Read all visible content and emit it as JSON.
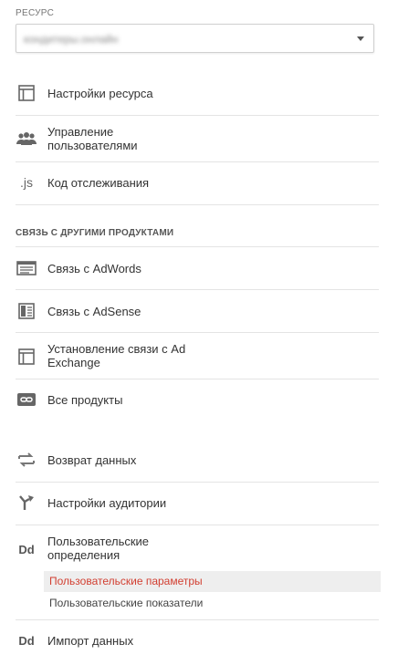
{
  "resource": {
    "section_label": "РЕСУРС",
    "selected_value": "кондитеры.онлайн"
  },
  "resource_items": [
    {
      "label": "Настройки ресурса",
      "icon": "panel-icon"
    },
    {
      "label_line1": "Управление",
      "label_line2": "пользователями",
      "icon": "users-icon"
    },
    {
      "label": "Код отслеживания",
      "icon": "js-icon",
      "icon_text": ".js"
    }
  ],
  "linking": {
    "title": "СВЯЗЬ С ДРУГИМИ ПРОДУКТАМИ",
    "items": [
      {
        "label": "Связь с AdWords",
        "icon": "adwords-icon"
      },
      {
        "label": "Связь с AdSense",
        "icon": "adsense-icon"
      },
      {
        "label_line1": "Установление связи с Ad",
        "label_line2": "Exchange",
        "icon": "ad-exchange-icon"
      },
      {
        "label": "Все продукты",
        "icon": "link-icon"
      }
    ]
  },
  "other": {
    "data_return": {
      "label": "Возврат данных",
      "icon": "data-return-icon"
    },
    "audience": {
      "label": "Настройки аудитории",
      "icon": "audience-icon"
    },
    "custom_definitions": {
      "label_line1": "Пользовательские",
      "label_line2": "определения",
      "icon": "dd-icon",
      "icon_text": "Dd",
      "sub_items": [
        "Пользовательские параметры",
        "Пользовательские показатели"
      ]
    },
    "data_import": {
      "label": "Импорт данных",
      "icon": "dd-icon",
      "icon_text": "Dd"
    }
  },
  "colors": {
    "active_sub": "#d23f31",
    "divider": "#e4e4e4"
  }
}
